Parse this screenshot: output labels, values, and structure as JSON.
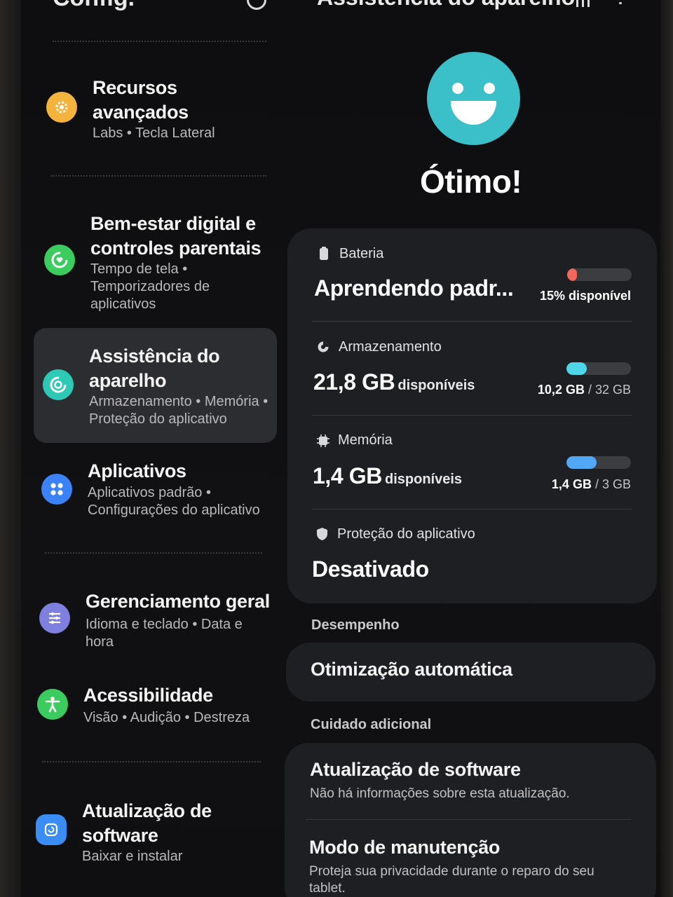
{
  "topbar": {
    "left_title": "Config.",
    "right_title": "Assistência do aparelho"
  },
  "sidebar": {
    "items": [
      {
        "title": "Recursos avançados",
        "subtitle": "Labs • Tecla Lateral",
        "icon": "gear-icon",
        "color": "#f3b33d"
      },
      {
        "title": "Bem-estar digital e controles parentais",
        "subtitle": "Tempo de tela • Temporizadores de aplicativos",
        "icon": "wellbeing-icon",
        "color": "#3ccb5f"
      },
      {
        "title": "Assistência do aparelho",
        "subtitle": "Armazenamento • Memória • Proteção do aplicativo",
        "icon": "device-care-icon",
        "color": "#2ec9b6"
      },
      {
        "title": "Aplicativos",
        "subtitle": "Aplicativos padrão • Configurações do aplicativo",
        "icon": "apps-icon",
        "color": "#3b82f6"
      },
      {
        "title": "Gerenciamento geral",
        "subtitle": "Idioma e teclado • Data e hora",
        "icon": "sliders-icon",
        "color": "#7f7fe0"
      },
      {
        "title": "Acessibilidade",
        "subtitle": "Visão • Audição • Destreza",
        "icon": "accessibility-icon",
        "color": "#3ccb5f"
      },
      {
        "title": "Atualização de software",
        "subtitle": "Baixar e instalar",
        "icon": "software-update-icon",
        "color": "#3b8df6"
      }
    ]
  },
  "device_care": {
    "status": "Ótimo!",
    "status_icon": "smiley-icon",
    "battery": {
      "label": "Bateria",
      "value": "Aprendendo padr...",
      "right": "15% disponível",
      "level": 0.15,
      "color": "#f2675a"
    },
    "storage": {
      "label": "Armazenamento",
      "value": "21,8 GB",
      "unit": "disponíveis",
      "used": "10,2 GB",
      "total": "/ 32 GB",
      "level": 0.32,
      "color": "#4fd6e8"
    },
    "memory": {
      "label": "Memória",
      "value": "1,4 GB",
      "unit": "disponíveis",
      "used": "1,4 GB",
      "total": "/ 3 GB",
      "level": 0.47,
      "color": "#52a8f5"
    },
    "protection": {
      "label": "Proteção do aplicativo",
      "value": "Desativado"
    },
    "performance": {
      "header": "Desempenho",
      "item": "Otimização automática"
    },
    "additional": {
      "header": "Cuidado adicional",
      "software_update": {
        "title": "Atualização de software",
        "subtitle": "Não há informações sobre esta atualização."
      },
      "maintenance": {
        "title": "Modo de manutenção",
        "subtitle": "Proteja sua privacidade durante o reparo do seu tablet."
      }
    }
  }
}
